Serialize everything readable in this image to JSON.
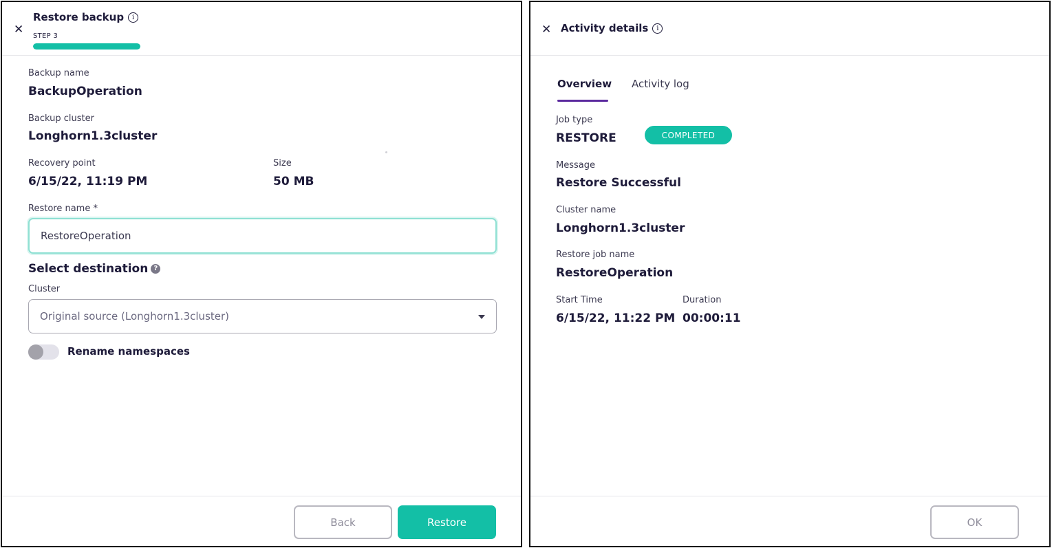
{
  "restore_dialog": {
    "title": "Restore backup",
    "info_glyph": "i",
    "step_label": "STEP 3",
    "progress_percent": 100,
    "fields": {
      "backup_name_label": "Backup name",
      "backup_name_value": "BackupOperation",
      "backup_cluster_label": "Backup cluster",
      "backup_cluster_value": "Longhorn1.3cluster",
      "recovery_point_label": "Recovery point",
      "recovery_point_value": "6/15/22, 11:19 PM",
      "size_label": "Size",
      "size_value": "50 MB",
      "restore_name_label": "Restore name *",
      "restore_name_value": "RestoreOperation"
    },
    "destination": {
      "title": "Select destination",
      "help_glyph": "?",
      "cluster_label": "Cluster",
      "cluster_selected": "Original source (Longhorn1.3cluster)"
    },
    "rename_namespaces": {
      "label": "Rename namespaces",
      "enabled": false
    },
    "buttons": {
      "back": "Back",
      "restore": "Restore"
    }
  },
  "activity_dialog": {
    "title": "Activity details",
    "info_glyph": "i",
    "tabs": [
      {
        "label": "Overview",
        "active": true
      },
      {
        "label": "Activity log",
        "active": false
      }
    ],
    "fields": {
      "job_type_label": "Job type",
      "job_type_value": "RESTORE",
      "status": "COMPLETED",
      "message_label": "Message",
      "message_value": "Restore Successful",
      "cluster_name_label": "Cluster name",
      "cluster_name_value": "Longhorn1.3cluster",
      "restore_job_name_label": "Restore job name",
      "restore_job_name_value": "RestoreOperation",
      "start_time_label": "Start Time",
      "start_time_value": "6/15/22, 11:22 PM",
      "duration_label": "Duration",
      "duration_value": "00:00:11"
    },
    "buttons": {
      "ok": "OK"
    }
  },
  "icons": {
    "close": "close-icon",
    "info": "info-icon",
    "help": "help-icon",
    "dropdown": "chevron-down-icon"
  },
  "colors": {
    "accent": "#13bfa6",
    "tab_indicator": "#5b2a9e",
    "text_primary": "#1e1b3a"
  }
}
